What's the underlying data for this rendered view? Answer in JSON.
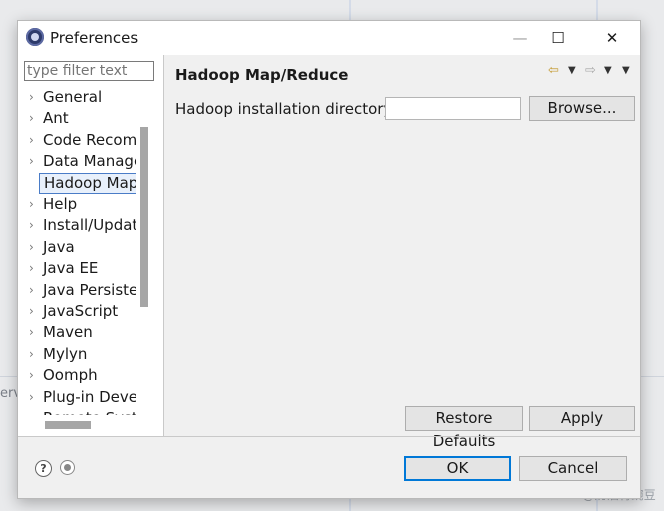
{
  "background": {
    "fragment_text": "erve",
    "watermark": "CSDN @奶油青豌豆"
  },
  "window": {
    "title": "Preferences",
    "controls": {
      "minimize": "—",
      "maximize": "☐",
      "close": "✕"
    }
  },
  "sidebar": {
    "filter_placeholder": "type filter text",
    "items": [
      {
        "label": "General",
        "expandable": true,
        "selected": false
      },
      {
        "label": "Ant",
        "expandable": true,
        "selected": false
      },
      {
        "label": "Code Recomr",
        "expandable": true,
        "selected": false
      },
      {
        "label": "Data Manage",
        "expandable": true,
        "selected": false
      },
      {
        "label": "Hadoop Map,",
        "expandable": false,
        "selected": true
      },
      {
        "label": "Help",
        "expandable": true,
        "selected": false
      },
      {
        "label": "Install/Update",
        "expandable": true,
        "selected": false
      },
      {
        "label": "Java",
        "expandable": true,
        "selected": false
      },
      {
        "label": "Java EE",
        "expandable": true,
        "selected": false
      },
      {
        "label": "Java Persisten",
        "expandable": true,
        "selected": false
      },
      {
        "label": "JavaScript",
        "expandable": true,
        "selected": false
      },
      {
        "label": "Maven",
        "expandable": true,
        "selected": false
      },
      {
        "label": "Mylyn",
        "expandable": true,
        "selected": false
      },
      {
        "label": "Oomph",
        "expandable": true,
        "selected": false
      },
      {
        "label": "Plug-in Devel",
        "expandable": true,
        "selected": false
      },
      {
        "label": "Remote Syst",
        "expandable": true,
        "selected": false
      }
    ]
  },
  "page": {
    "title": "Hadoop Map/Reduce",
    "nav": {
      "back_icon": "⇦",
      "forward_icon": "⇨",
      "dropdown_icon": "▼",
      "menu_icon": "▼"
    },
    "install_dir_label": "Hadoop installation directory:",
    "install_dir_value": "",
    "browse_label": "Browse...",
    "restore_defaults_label": "Restore Defaults",
    "apply_label": "Apply"
  },
  "footer": {
    "help_icon": "?",
    "ok_label": "OK",
    "cancel_label": "Cancel"
  },
  "colors": {
    "accent": "#0078d7",
    "selection_border": "#4a7cc7",
    "nav_arrow": "#c49a30"
  }
}
